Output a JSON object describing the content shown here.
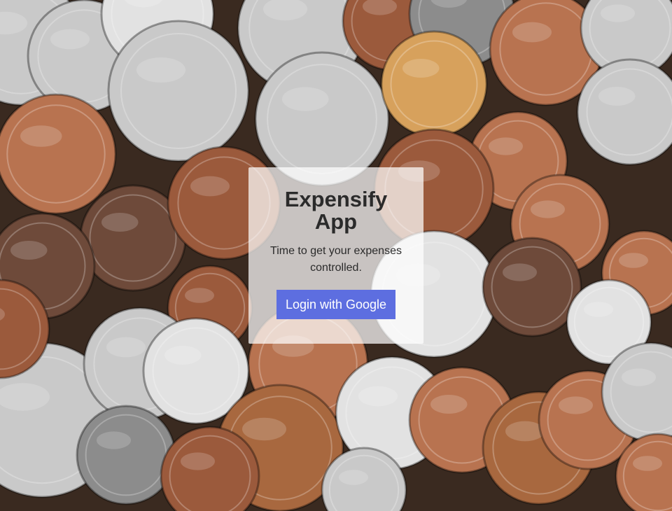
{
  "app": {
    "title": "Expensify App",
    "subtitle": "Time to get your expenses controlled.",
    "login_label": "Login with Google"
  },
  "background": {
    "description_icon": "coins-photo",
    "coin_colors": [
      "#b87350",
      "#c9c9c9",
      "#9b5a3c",
      "#d7a15c",
      "#8c8c8c",
      "#6e4a3a",
      "#e2e2e2",
      "#a8683f"
    ]
  },
  "colors": {
    "button": "#5d6ee0",
    "panel": "rgba(255,255,255,0.72)",
    "text": "#2b2b2b"
  }
}
